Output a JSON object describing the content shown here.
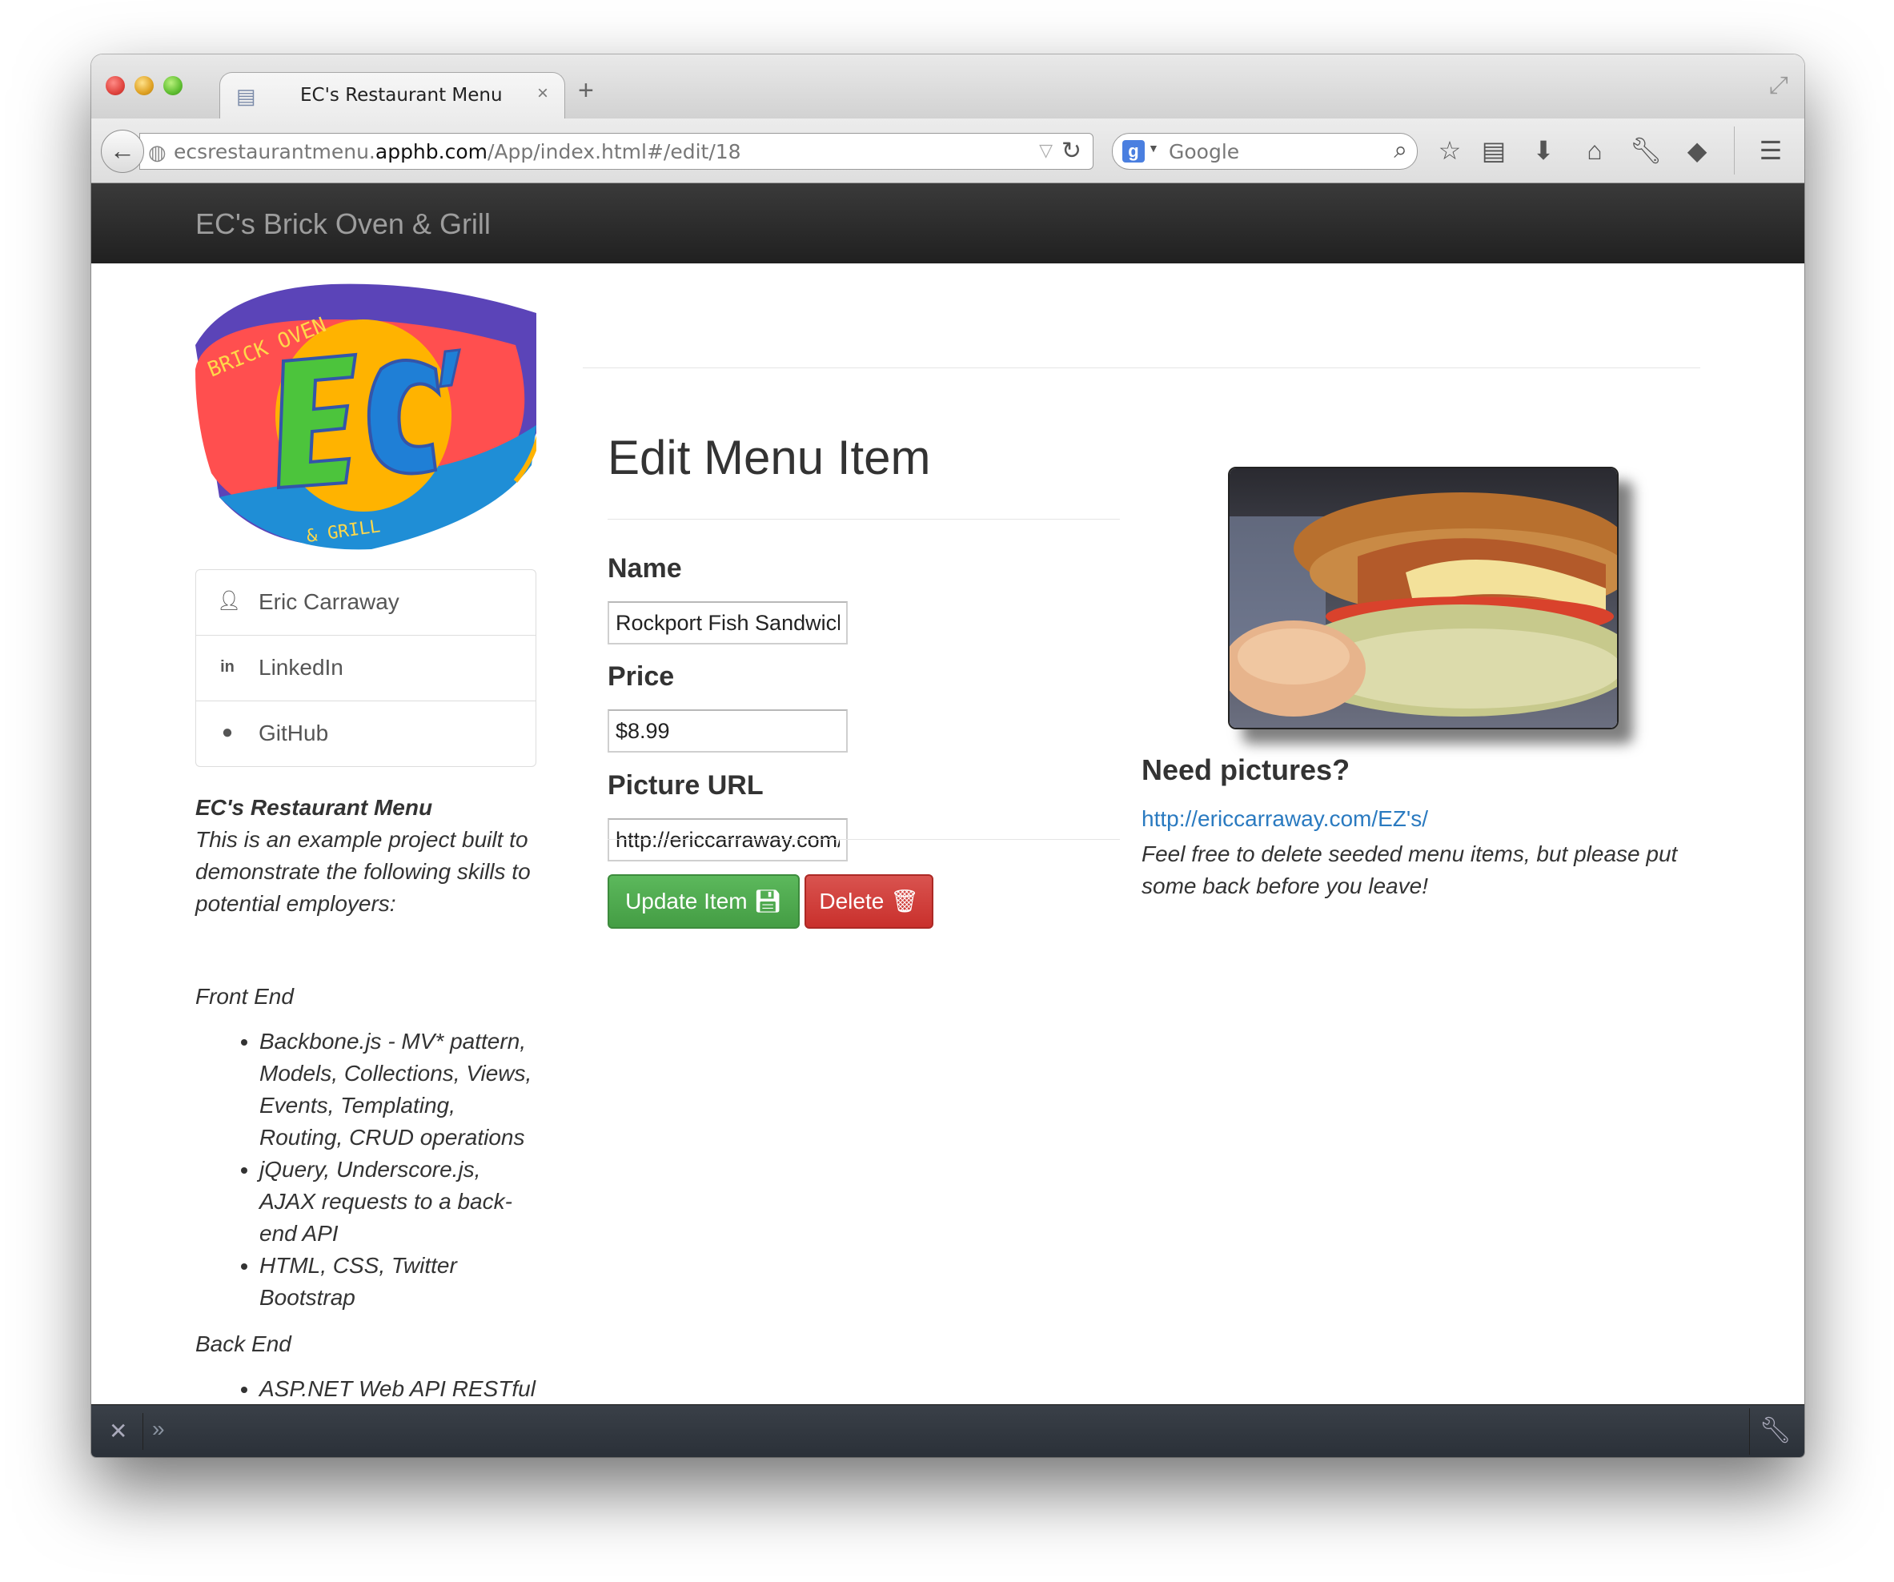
{
  "browser": {
    "tab_title": "EC's Restaurant Menu",
    "tab_close": "×",
    "new_tab": "+",
    "url_prefix": "ecsrestaurantmenu.",
    "url_host": "apphb.com",
    "url_path": "/App/index.html#/edit/18",
    "search_engine_badge": "g",
    "search_placeholder": "Google",
    "icons": [
      "back-arrow-icon",
      "globe-icon",
      "reload-icon",
      "search-icon",
      "star-icon",
      "reading-list-icon",
      "download-icon",
      "home-icon",
      "wrench-icon",
      "pocket-icon",
      "menu-icon"
    ]
  },
  "navbar": {
    "brand": "EC's Brick Oven & Grill"
  },
  "logo": {
    "top_text": "BRICK OVEN",
    "center_text": "EC'",
    "bottom_text": "& GRILL"
  },
  "sidebar": {
    "links": [
      {
        "label": "Eric Carraway",
        "icon": "user-icon"
      },
      {
        "label": "LinkedIn",
        "icon": "linkedin-icon"
      },
      {
        "label": "GitHub",
        "icon": "github-icon"
      }
    ],
    "about": {
      "title": "EC's Restaurant Menu",
      "intro": "This is an example project built to demonstrate the following skills to potential employers:",
      "front_end_heading": "Front End",
      "front_end_items": [
        "Backbone.js - MV* pattern, Models, Collections, Views, Events, Templating, Routing, CRUD operations",
        "jQuery, Underscore.js, AJAX requests to a back-end API",
        "HTML, CSS, Twitter Bootstrap"
      ],
      "back_end_heading": "Back End",
      "back_end_items": [
        "ASP.NET Web API RESTful"
      ]
    }
  },
  "form": {
    "heading": "Edit Menu Item",
    "name_label": "Name",
    "name_value": "Rockport Fish Sandwich",
    "price_label": "Price",
    "price_value": "$8.99",
    "picture_label": "Picture URL",
    "picture_value": "http://ericcarraway.com/EZ's/",
    "update_label": "Update Item",
    "delete_label": "Delete"
  },
  "aside": {
    "heading": "Need pictures?",
    "link": "http://ericcarraway.com/EZ's/",
    "note": "Feel free to delete seeded menu items, but please put some back before you leave!"
  },
  "colors": {
    "navbar": "#222222",
    "brand_text": "#9d9d9d",
    "success": "#5cb85c",
    "danger": "#d9534f",
    "link": "#2a7ac0"
  }
}
